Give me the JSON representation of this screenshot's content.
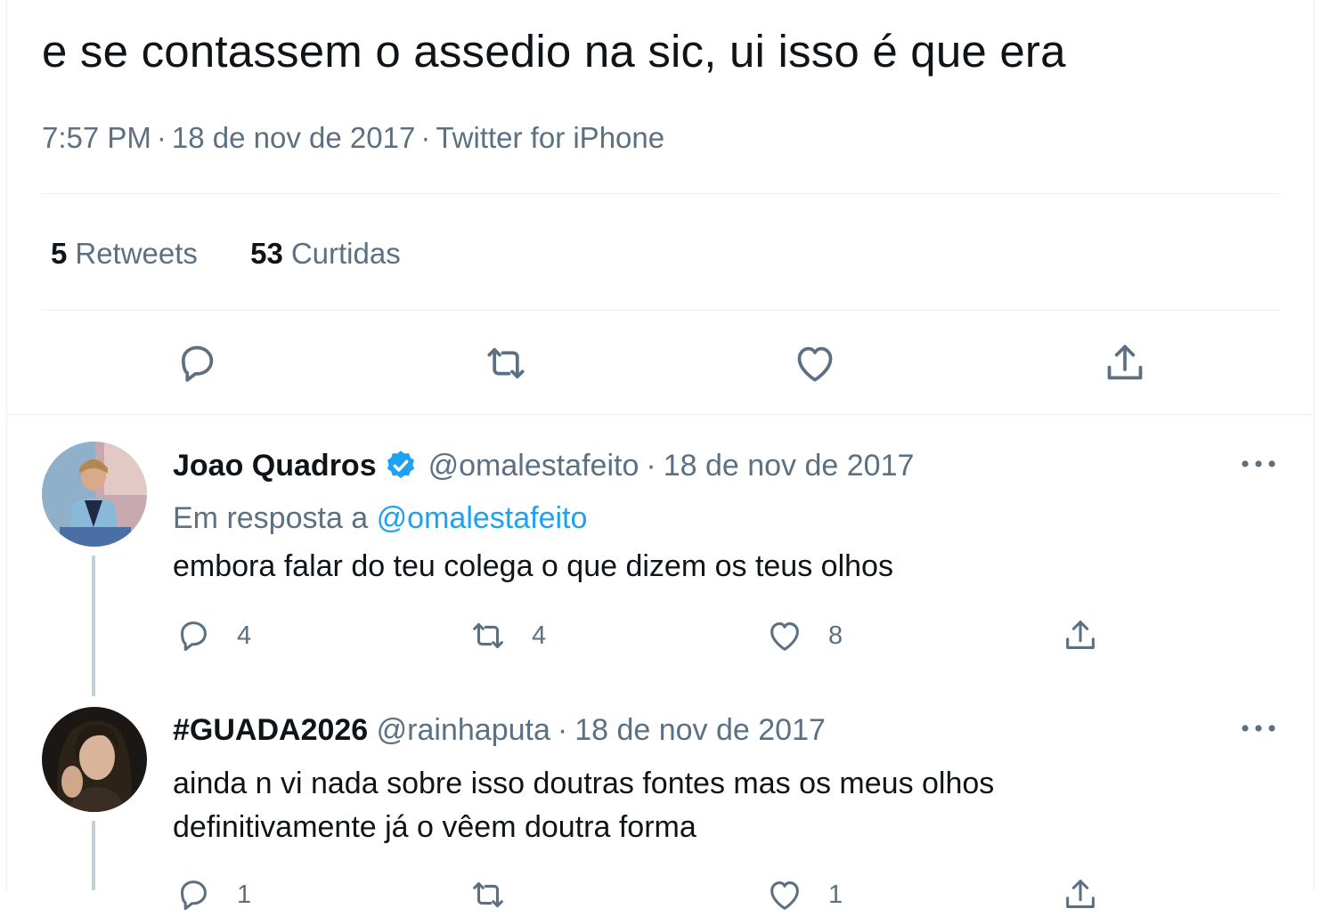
{
  "tweet": {
    "text": "e se contassem o assedio na sic, ui isso é que era",
    "time": "7:57 PM",
    "date": "18 de nov de 2017",
    "source": "Twitter for iPhone",
    "separator": "·",
    "retweets_count": "5",
    "retweets_label": "Retweets",
    "likes_count": "53",
    "likes_label": "Curtidas"
  },
  "replies": [
    {
      "name": "Joao Quadros",
      "verified": true,
      "handle": "@omalestafeito",
      "date": "18 de nov de 2017",
      "reply_prefix": "Em resposta a",
      "reply_mention": "@omalestafeito",
      "text": "embora falar do teu colega o que dizem os teus olhos",
      "reply_count": "4",
      "retweet_count": "4",
      "like_count": "8"
    },
    {
      "name": "#GUADA2026",
      "verified": false,
      "handle": "@rainhaputa",
      "date": "18 de nov de 2017",
      "text_line1": "ainda n vi nada sobre isso doutras fontes mas os meus olhos",
      "text_line2": "definitivamente já o vêem doutra forma",
      "reply_count": "1",
      "like_count": "1"
    }
  ],
  "colors": {
    "text": "#0f1419",
    "secondary": "#5b7083",
    "accent": "#1da1f2",
    "divider": "#ebeef0",
    "thread_line": "#c4cfd6"
  },
  "icons": [
    "reply-icon",
    "retweet-icon",
    "like-icon",
    "share-icon",
    "verified-icon",
    "more-icon"
  ]
}
